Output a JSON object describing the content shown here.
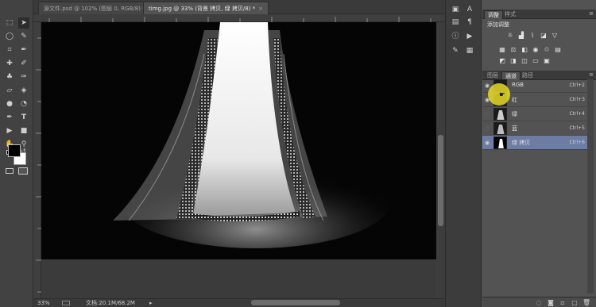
{
  "tabs": [
    {
      "label": "源文件.psd @ 102% (图层 0, RGB/8) *",
      "close": "×"
    },
    {
      "label": "timg.jpg @ 33% (背景 拷贝, 绿 拷贝/8) *",
      "close": "×"
    }
  ],
  "status": {
    "zoom": "33%",
    "doc_info": "文档:20.1M/68.2M",
    "arrow": "▸"
  },
  "panel": {
    "tabs": [
      "调整",
      "样式"
    ],
    "adjustments_title": "添加调整",
    "bottom_tabs": [
      "图层",
      "通道",
      "路径"
    ],
    "channels": [
      {
        "name": "RGB",
        "shortcut": "Ctrl+2",
        "visible": true,
        "selected": false
      },
      {
        "name": "红",
        "shortcut": "Ctrl+3",
        "visible": true,
        "selected": false
      },
      {
        "name": "绿",
        "shortcut": "Ctrl+4",
        "visible": false,
        "selected": false
      },
      {
        "name": "蓝",
        "shortcut": "Ctrl+5",
        "visible": false,
        "selected": false
      },
      {
        "name": "绿 拷贝",
        "shortcut": "Ctrl+6",
        "visible": true,
        "selected": true
      }
    ]
  },
  "colors": {
    "foreground": "#000000",
    "background": "#ffffff",
    "selection": "#6c7ca3",
    "cursor_highlight": "#e8da28"
  },
  "icons": {
    "eye": "eye-icon",
    "menu": "panel-menu-icon"
  }
}
